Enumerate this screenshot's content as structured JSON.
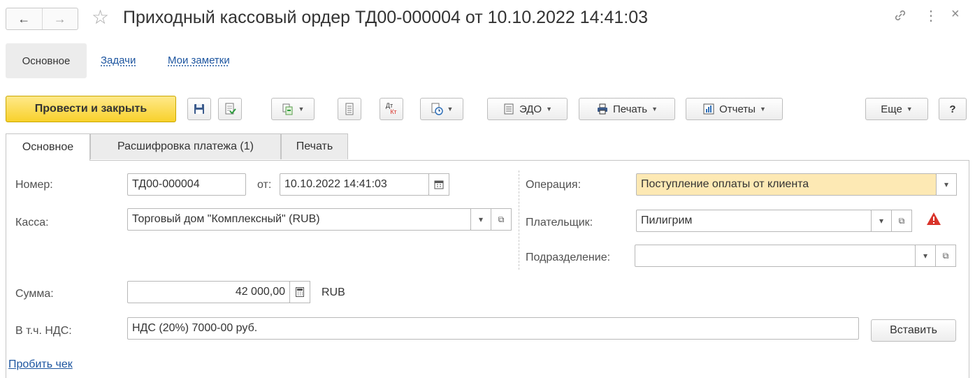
{
  "window": {
    "title": "Приходный кассовый ордер ТД00-000004 от 10.10.2022 14:41:03",
    "back_glyph": "←",
    "forward_glyph": "→",
    "star_glyph": "☆",
    "link_glyph": "🔗",
    "more_glyph": "⋮",
    "close_glyph": "×"
  },
  "sections": {
    "main": "Основное",
    "tasks": "Задачи",
    "notes": "Мои заметки"
  },
  "toolbar": {
    "post_close": "Провести и закрыть",
    "edo": "ЭДО",
    "print": "Печать",
    "reports": "Отчеты",
    "more": "Еще",
    "help": "?",
    "dt": "Дт",
    "kt": "Кт"
  },
  "tabs": [
    {
      "label": "Основное"
    },
    {
      "label": "Расшифровка платежа (1)"
    },
    {
      "label": "Печать"
    }
  ],
  "form": {
    "number_label": "Номер:",
    "number_value": "ТД00-000004",
    "date_label": "от:",
    "date_value": "10.10.2022 14:41:03",
    "cash_label": "Касса:",
    "cash_value": "Торговый дом \"Комплексный\" (RUB)",
    "operation_label": "Операция:",
    "operation_value": "Поступление оплаты от клиента",
    "payer_label": "Плательщик:",
    "payer_value": "Пилигрим",
    "division_label": "Подразделение:",
    "division_value": "",
    "sum_label": "Сумма:",
    "sum_value": "42 000,00",
    "currency": "RUB",
    "vat_label": "В т.ч. НДС:",
    "vat_value": "НДС (20%) 7000-00 руб.",
    "insert_button": "Вставить",
    "receipt_link": "Пробить чек"
  },
  "colors": {
    "accent_yellow": "#f8d12b",
    "highlight_field": "#fde9b4",
    "link_blue": "#1e56a0",
    "warning_red": "#d9342b"
  }
}
